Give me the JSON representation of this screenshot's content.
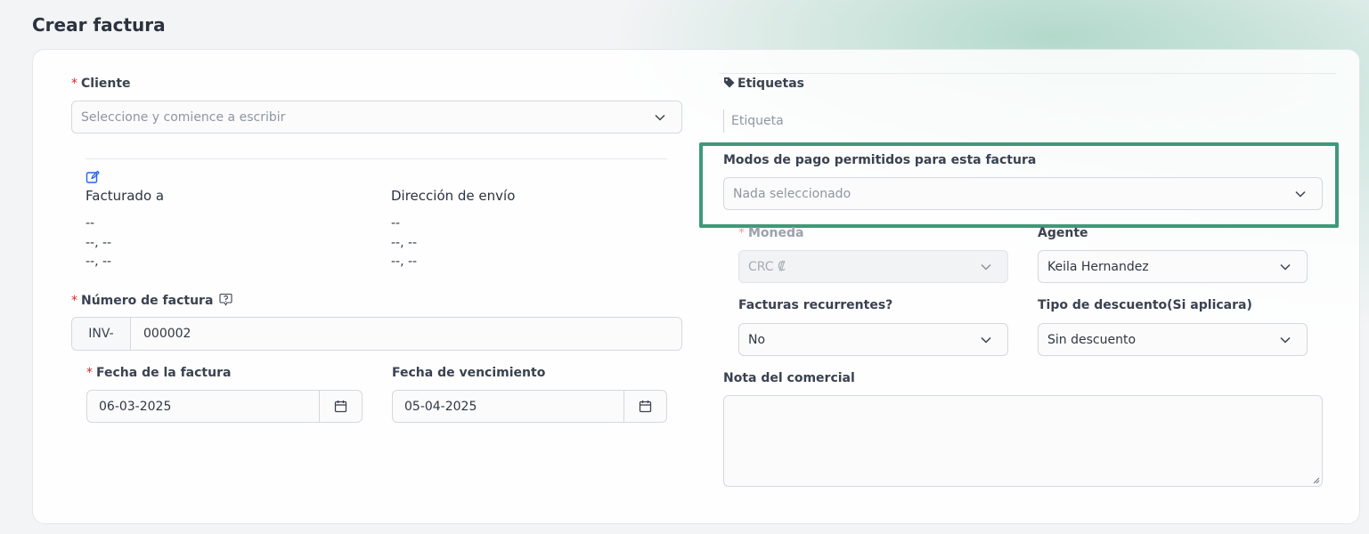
{
  "page": {
    "title": "Crear factura"
  },
  "cliente": {
    "label": "Cliente",
    "required_mark": "*",
    "placeholder": "Seleccione y comience a escribir"
  },
  "billing": {
    "edit_icon": "edit-icon",
    "bill_to_title": "Facturado a",
    "ship_to_title": "Dirección de envío",
    "bill_to_lines": [
      "--",
      "--, --",
      "--, --"
    ],
    "ship_to_lines": [
      "--",
      "--, --",
      "--, --"
    ]
  },
  "invoice_number": {
    "label": "Número de factura",
    "required_mark": "*",
    "help_icon": "help-icon",
    "prefix": "INV-",
    "value": "000002"
  },
  "invoice_date": {
    "label": "Fecha de la factura",
    "required_mark": "*",
    "value": "06-03-2025",
    "icon": "calendar-icon"
  },
  "due_date": {
    "label": "Fecha de vencimiento",
    "value": "05-04-2025",
    "icon": "calendar-icon"
  },
  "tags": {
    "label": "Etiquetas",
    "icon": "tag-icon",
    "placeholder": "Etiqueta"
  },
  "payment_modes": {
    "label": "Modos de pago permitidos para esta factura",
    "placeholder": "Nada seleccionado",
    "highlight_color": "#3d9a78"
  },
  "currency": {
    "label": "Moneda",
    "required_mark": "*",
    "value": "CRC ₡"
  },
  "agent": {
    "label": "Agente",
    "value": "Keila Hernandez"
  },
  "recurring": {
    "label": "Facturas recurrentes?",
    "value": "No"
  },
  "discount_type": {
    "label": "Tipo de descuento(Si aplicara)",
    "value": "Sin descuento"
  },
  "admin_note": {
    "label": "Nota del comercial",
    "value": ""
  }
}
